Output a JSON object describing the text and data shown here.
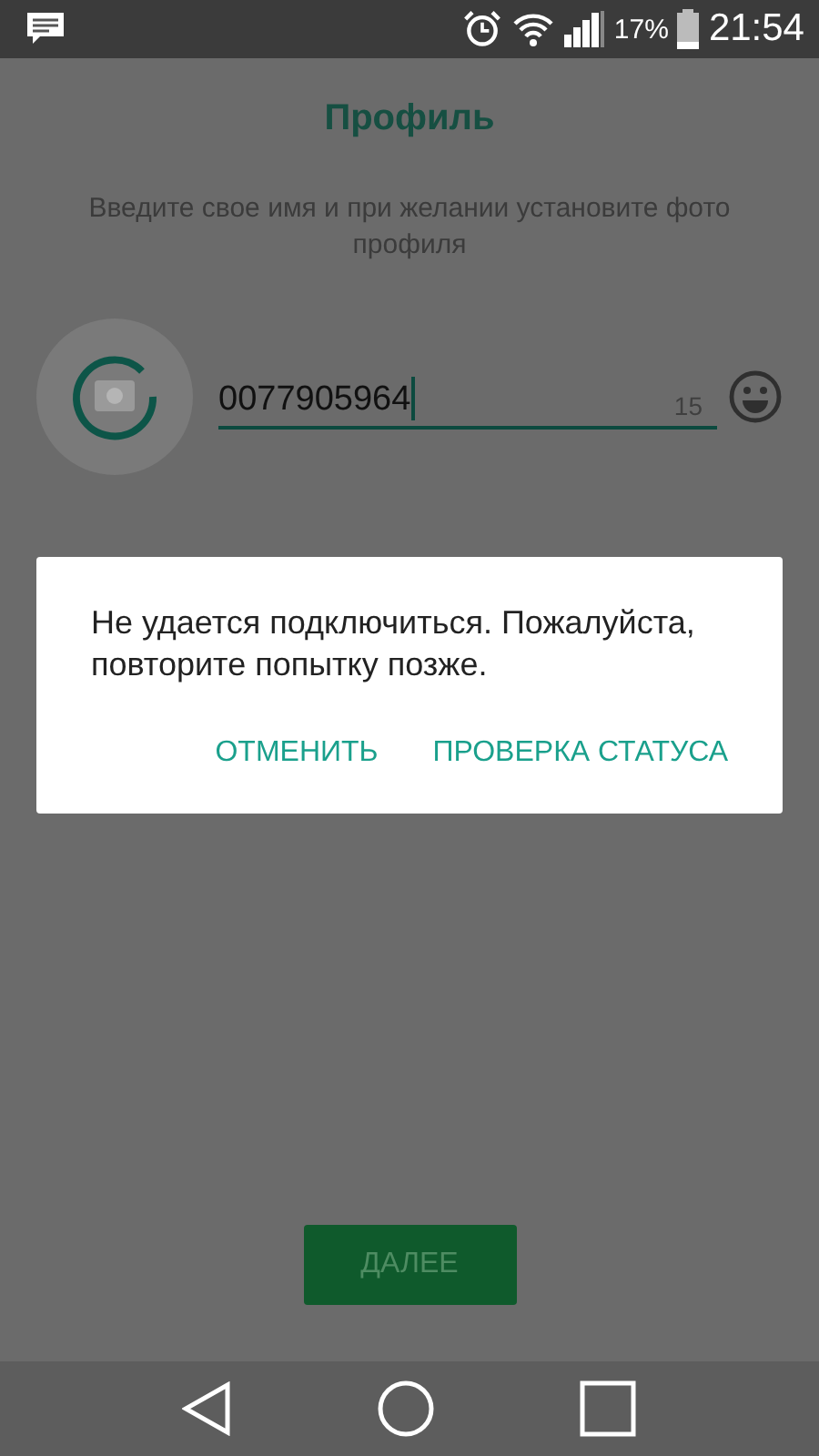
{
  "status_bar": {
    "battery": "17%",
    "time": "21:54"
  },
  "title": "Профиль",
  "subtitle": "Введите свое имя и при желании установите фото профиля",
  "name_field": {
    "value": "0077905964",
    "counter": "15"
  },
  "next_button": "ДАЛЕЕ",
  "dialog": {
    "message": "Не удается подключиться. Пожалуйста, повторите попытку позже.",
    "buttons": [
      "ОТМЕНИТЬ",
      "ПРОВЕРКА СТАТУСА"
    ]
  }
}
